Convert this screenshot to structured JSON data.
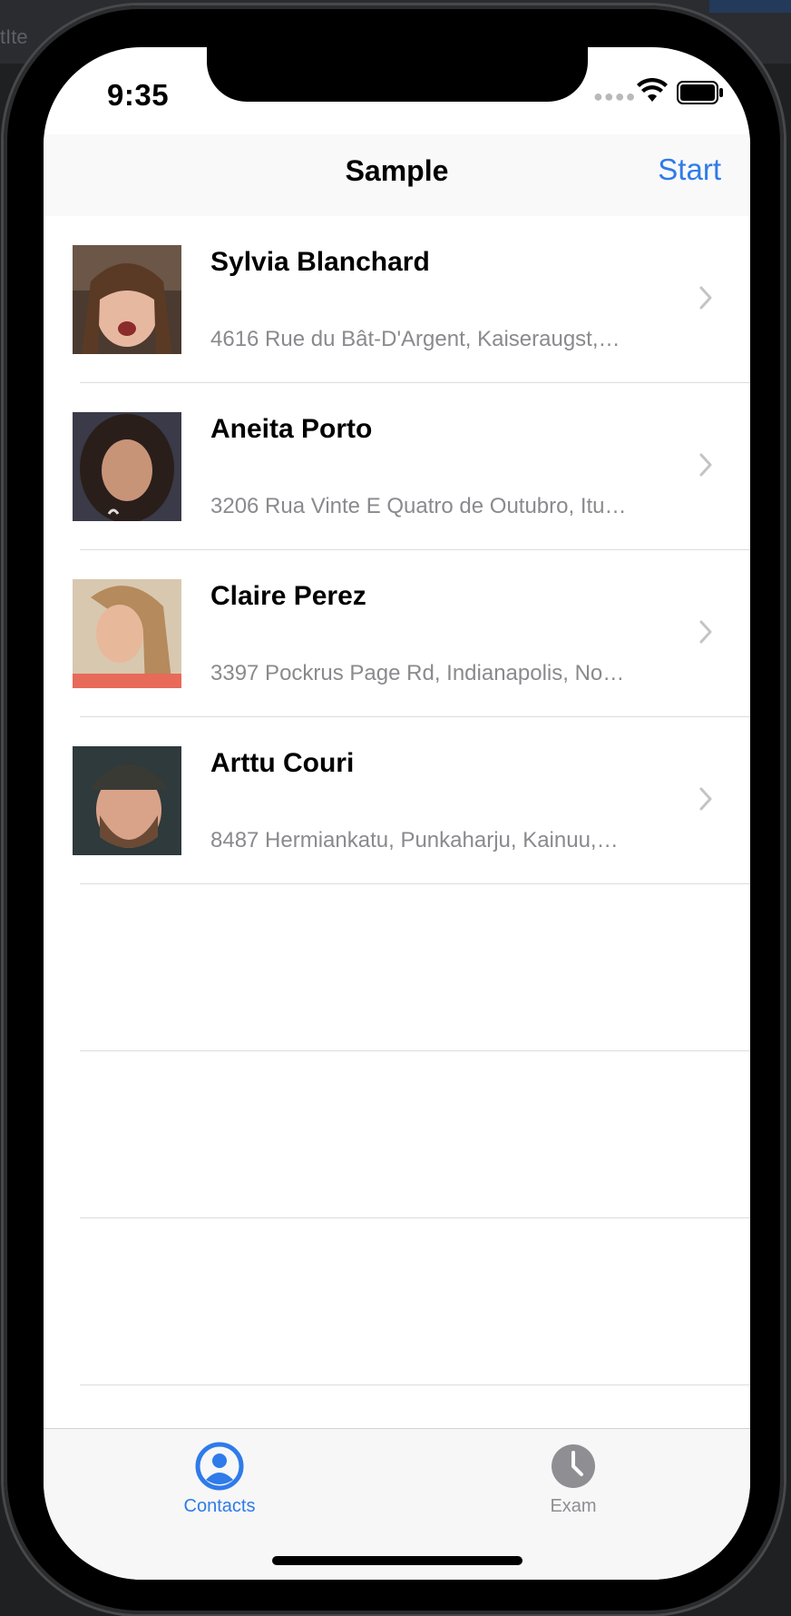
{
  "background": {
    "partial_text": "tIte"
  },
  "status_bar": {
    "time": "9:35"
  },
  "nav": {
    "title": "Sample",
    "start_label": "Start"
  },
  "contacts": [
    {
      "name": "Sylvia Blanchard",
      "address": "4616 Rue du Bât-D'Argent, Kaiseraugst,…"
    },
    {
      "name": "Aneita Porto",
      "address": "3206 Rua Vinte E Quatro de Outubro, Itu…"
    },
    {
      "name": "Claire Perez",
      "address": "3397 Pockrus Page Rd, Indianapolis, No…"
    },
    {
      "name": "Arttu Couri",
      "address": "8487 Hermiankatu, Punkaharju, Kainuu,…"
    }
  ],
  "tabs": [
    {
      "label": "Contacts",
      "icon": "person-circle-icon",
      "selected": true
    },
    {
      "label": "Exam",
      "icon": "clock-icon",
      "selected": false
    }
  ],
  "colors": {
    "accent": "#2f7bea",
    "secondary_text": "#8a8a8e",
    "separator": "#dcdcdf"
  }
}
